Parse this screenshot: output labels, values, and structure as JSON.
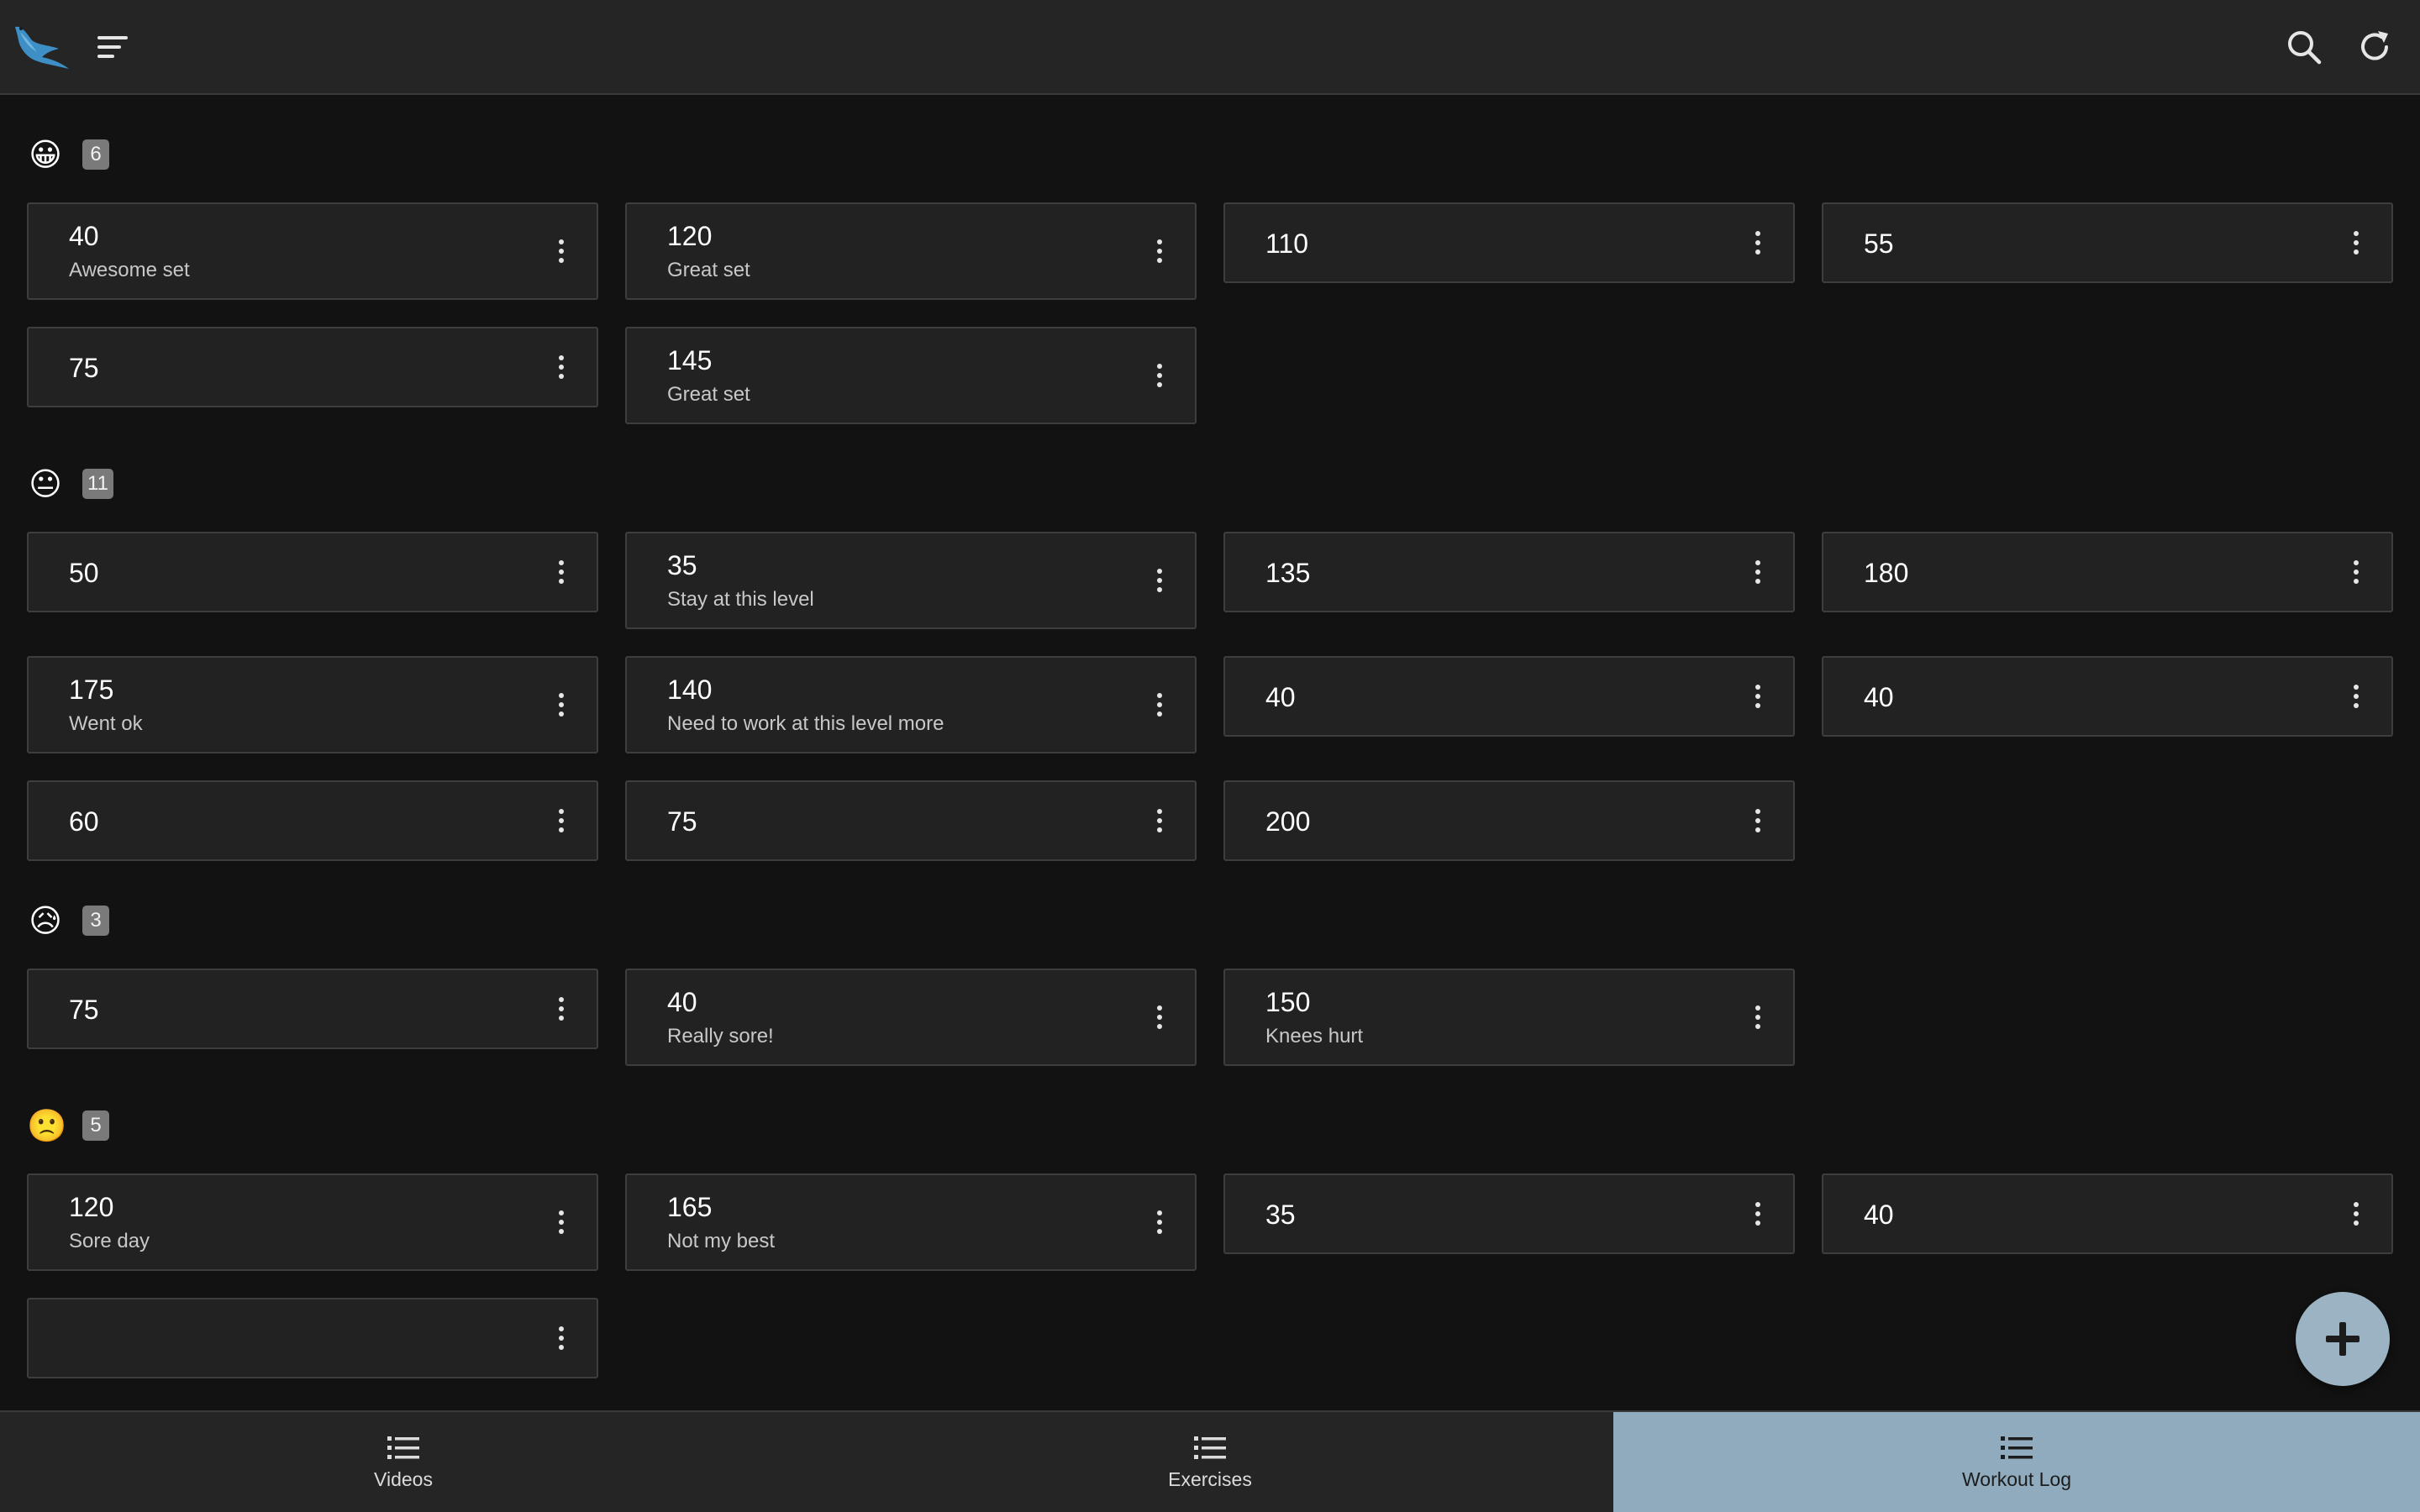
{
  "app": {
    "logo_icon": "bird-logo-icon",
    "menu_icon": "menu-icon",
    "search_icon": "search-icon",
    "refresh_icon": "refresh-icon"
  },
  "groups": [
    {
      "emoji": "😀",
      "count": "6",
      "cards": [
        {
          "value": "40",
          "note": "Awesome set"
        },
        {
          "value": "120",
          "note": "Great set"
        },
        {
          "value": "110",
          "note": ""
        },
        {
          "value": "55",
          "note": ""
        },
        {
          "value": "75",
          "note": ""
        },
        {
          "value": "145",
          "note": "Great set"
        }
      ]
    },
    {
      "emoji": "😐",
      "count": "11",
      "cards": [
        {
          "value": "50",
          "note": ""
        },
        {
          "value": "35",
          "note": "Stay at this level"
        },
        {
          "value": "135",
          "note": ""
        },
        {
          "value": "180",
          "note": ""
        },
        {
          "value": "175",
          "note": "Went ok"
        },
        {
          "value": "140",
          "note": "Need to work at this level more"
        },
        {
          "value": "40",
          "note": ""
        },
        {
          "value": "40",
          "note": ""
        },
        {
          "value": "60",
          "note": ""
        },
        {
          "value": "75",
          "note": ""
        },
        {
          "value": "200",
          "note": ""
        }
      ]
    },
    {
      "emoji": "😥",
      "count": "3",
      "cards": [
        {
          "value": "75",
          "note": ""
        },
        {
          "value": "40",
          "note": "Really sore!"
        },
        {
          "value": "150",
          "note": "Knees hurt"
        }
      ]
    },
    {
      "emoji": "🙁",
      "count": "5",
      "cards": [
        {
          "value": "120",
          "note": "Sore day"
        },
        {
          "value": "165",
          "note": "Not my best"
        },
        {
          "value": "35",
          "note": ""
        },
        {
          "value": "40",
          "note": ""
        },
        {
          "value": "",
          "note": ""
        }
      ]
    }
  ],
  "fab": {
    "icon": "plus-icon"
  },
  "bottom_nav": [
    {
      "label": "Videos",
      "icon": "list-icon",
      "active": false
    },
    {
      "label": "Exercises",
      "icon": "list-icon",
      "active": false
    },
    {
      "label": "Workout Log",
      "icon": "list-icon",
      "active": true
    }
  ],
  "colors": {
    "background": "#121212",
    "bar": "#252525",
    "card": "#222222",
    "accent": "#8fabbd",
    "fab": "#9bb3c2"
  }
}
